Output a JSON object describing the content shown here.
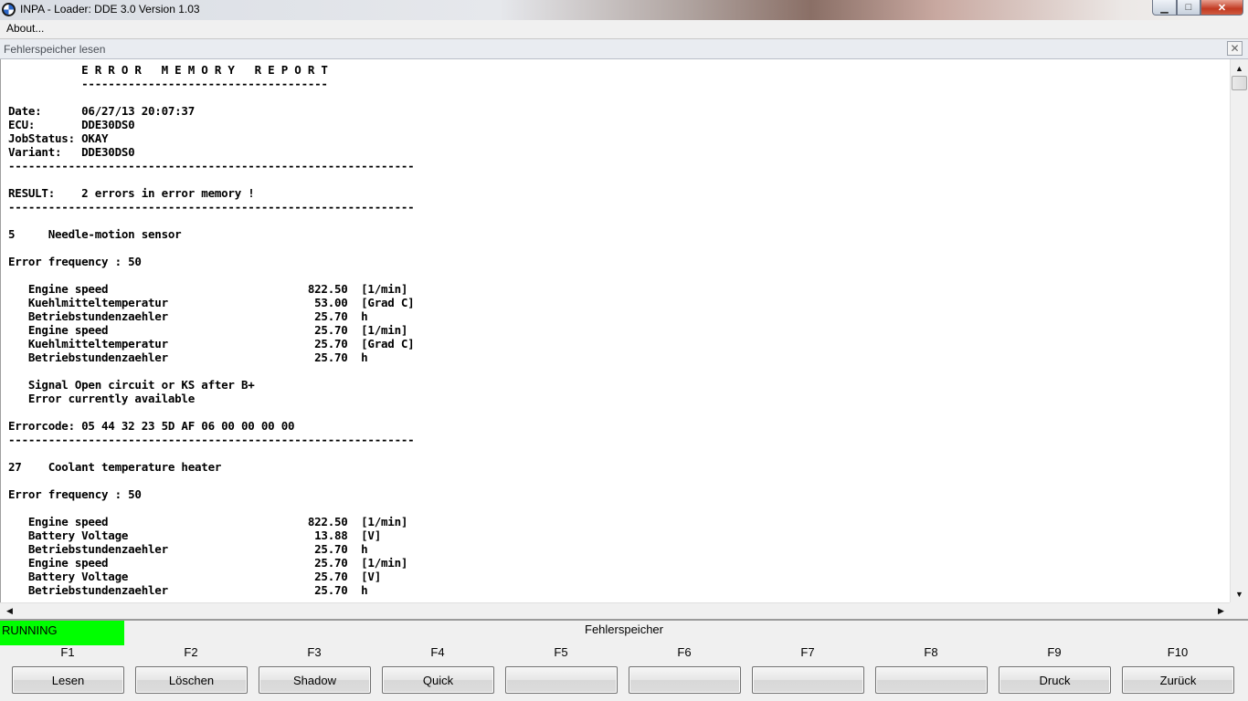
{
  "window": {
    "title": "INPA - Loader:  DDE 3.0 Version 1.03",
    "icons": {
      "app": "bmw-logo-icon",
      "minimize": "minimize-icon",
      "maximize": "maximize-icon",
      "close": "close-icon"
    },
    "min_glyph": "▁",
    "max_glyph": "□",
    "close_glyph": "✕"
  },
  "menu": {
    "about_label": "About..."
  },
  "document": {
    "title": "Fehlerspeicher lesen",
    "close_glyph": "✕",
    "report_lines": [
      "           E R R O R   M E M O R Y   R E P O R T",
      "           -------------------------------------",
      "",
      "Date:      06/27/13 20:07:37",
      "ECU:       DDE30DS0",
      "JobStatus: OKAY",
      "Variant:   DDE30DS0",
      "-------------------------------------------------------------",
      "",
      "RESULT:    2 errors in error memory !",
      "-------------------------------------------------------------",
      "",
      "5     Needle-motion sensor",
      "",
      "Error frequency : 50",
      "",
      "   Engine speed                              822.50  [1/min]",
      "   Kuehlmitteltemperatur                      53.00  [Grad C]",
      "   Betriebstundenzaehler                      25.70  h",
      "   Engine speed                               25.70  [1/min]",
      "   Kuehlmitteltemperatur                      25.70  [Grad C]",
      "   Betriebstundenzaehler                      25.70  h",
      "",
      "   Signal Open circuit or KS after B+",
      "   Error currently available",
      "",
      "Errorcode: 05 44 32 23 5D AF 06 00 00 00 00",
      "-------------------------------------------------------------",
      "",
      "27    Coolant temperature heater",
      "",
      "Error frequency : 50",
      "",
      "   Engine speed                              822.50  [1/min]",
      "   Battery Voltage                            13.88  [V]",
      "   Betriebstundenzaehler                      25.70  h",
      "   Engine speed                               25.70  [1/min]",
      "   Battery Voltage                            25.70  [V]",
      "   Betriebstundenzaehler                      25.70  h"
    ]
  },
  "scrollbars": {
    "up_glyph": "▲",
    "down_glyph": "▼",
    "left_glyph": "◀",
    "right_glyph": "▶",
    "icons": {
      "up": "scroll-up-icon",
      "down": "scroll-down-icon",
      "left": "scroll-left-icon",
      "right": "scroll-right-icon"
    }
  },
  "status": {
    "text": "RUNNING",
    "color": "#00ff00"
  },
  "panel": {
    "title": "Fehlerspeicher"
  },
  "function_keys": [
    {
      "key": "F1",
      "label": "Lesen"
    },
    {
      "key": "F2",
      "label": "Löschen"
    },
    {
      "key": "F3",
      "label": "Shadow"
    },
    {
      "key": "F4",
      "label": "Quick"
    },
    {
      "key": "F5",
      "label": ""
    },
    {
      "key": "F6",
      "label": ""
    },
    {
      "key": "F7",
      "label": ""
    },
    {
      "key": "F8",
      "label": ""
    },
    {
      "key": "F9",
      "label": "Druck"
    },
    {
      "key": "F10",
      "label": "Zurück"
    }
  ]
}
